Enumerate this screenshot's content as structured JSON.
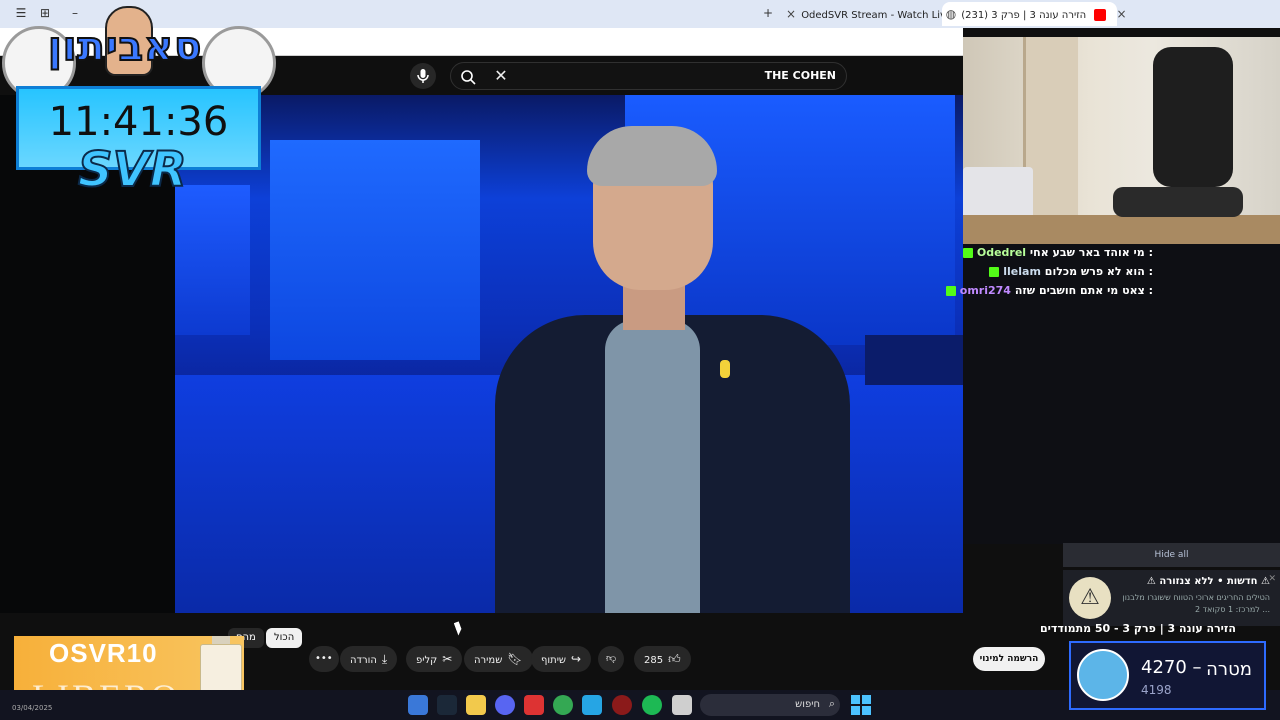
{
  "browser": {
    "window_controls": [
      "☰",
      "⊞",
      "–"
    ],
    "tabs": [
      {
        "title": "OdedSVR Stream - Watch Live",
        "favicon_color": "#53fc18",
        "active": false
      },
      {
        "title": "(231) הזירה עונה 3 | פרק 3",
        "favicon_color": "#ff0000",
        "active": true
      }
    ],
    "new_tab": "+",
    "close_glyph": "×"
  },
  "youtube": {
    "search_query": "THE COHEN",
    "search_icon": "search-icon",
    "mic_icon": "mic-icon"
  },
  "overlay": {
    "timer": "11:41:36",
    "brand": "SVR",
    "logo_text": "סאביתון"
  },
  "chat": {
    "messages": [
      {
        "user": "Odedrel",
        "text": "מי אוהד באר שבע אחי :",
        "color": "#b8ff9a"
      },
      {
        "user": "llelam",
        "text": "הוא לא פרש מכלום :",
        "color": "#cde"
      },
      {
        "user": "omri274",
        "text": "צאט מי אתם חושבים שזה :",
        "color": "#c08aff"
      }
    ]
  },
  "notifications": {
    "hide_all": "Hide all",
    "item": {
      "title": "⚠ חדשות • ללא צנזורה ⚠",
      "body": "הטילים החריגים ארוכי הטווח ששוגרו מלבנון למרכז: 1 סקואד 2 ...",
      "icon": "warning-icon"
    }
  },
  "video": {
    "title_partial": "הזירה עונה 3 | פרק 3 - 50 מתמודדים",
    "subscribe": "הרשמה למינוי",
    "chips": [
      "הכול",
      "מהס"
    ],
    "likes": "285",
    "share": "שיתוף",
    "save": "שמירה",
    "clip": "קליפ",
    "download": "הורדה",
    "more": "•••"
  },
  "promo": {
    "code": "OSVR10",
    "brand": "LIBERO"
  },
  "taskbar": {
    "search_placeholder": "חיפוש",
    "date": "03/04/2025",
    "icons": [
      "store-icon",
      "steam-icon",
      "folder-icon",
      "discord-icon",
      "app-icon",
      "chrome-icon",
      "app2-icon",
      "app3-icon",
      "spotify-icon",
      "window-icon"
    ]
  },
  "goal": {
    "label": "מטרה",
    "target": "4270 –",
    "current": "4198"
  }
}
